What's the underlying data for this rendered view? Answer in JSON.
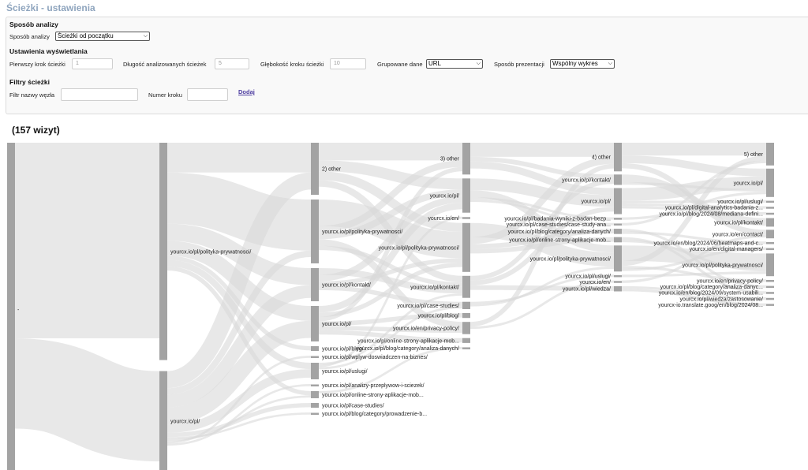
{
  "page_title": "Ścieżki - ustawienia",
  "analysis": {
    "section_title": "Sposób analizy",
    "method_label": "Sposób analizy",
    "method_value": "Ścieżki od początku"
  },
  "display": {
    "section_title": "Ustawienia wyświetlania",
    "first_step_label": "Pierwszy krok ścieżki",
    "first_step_value": "1",
    "length_label": "Długość analizowanych ścieżek",
    "length_value": "5",
    "depth_label": "Głębokość kroku ścieżki",
    "depth_value": "10",
    "grouped_label": "Grupowane dane",
    "grouped_value": "URL",
    "presentation_label": "Sposób prezentacji",
    "presentation_value": "Wspólny wykres"
  },
  "filters": {
    "section_title": "Filtry ścieżki",
    "node_name_label": "Filtr nazwy węzła",
    "step_number_label": "Numer kroku",
    "add_label": "Dodaj"
  },
  "visits_label": "(157 wizyt)",
  "colors": {
    "node": "#a3a3a3",
    "link": "#d8d8d8",
    "title": "#8fa5be",
    "link_text": "#4b3b9f"
  },
  "chart_data": {
    "type": "sankey",
    "total_visits": 157,
    "columns": [
      {
        "step": 0,
        "nodes": [
          {
            "id": "root",
            "label": "-",
            "value": 157
          }
        ]
      },
      {
        "step": 1,
        "nodes": [
          {
            "id": "s1-polityka",
            "label": "yourcx.io/pl/polityka-prywatnosci/",
            "value": 104
          },
          {
            "id": "s1-pl",
            "label": "yourcx.io/pl/",
            "value": 48
          }
        ]
      },
      {
        "step": 2,
        "nodes": [
          {
            "id": "s2-other",
            "label": "2) other",
            "value": 22
          },
          {
            "id": "s2-polityka",
            "label": "yourcx.io/pl/polityka-prywatnosci/",
            "value": 27
          },
          {
            "id": "s2-kontakt",
            "label": "yourcx.io/pl/kontakt/",
            "value": 14
          },
          {
            "id": "s2-pl",
            "label": "yourcx.io/pl/",
            "value": 15
          },
          {
            "id": "s2-blog",
            "label": "yourcx.io/pl/blog/",
            "value": 2
          },
          {
            "id": "s2-wplyw",
            "label": "yourcx.io/pl/wplyw-doswiadczen-na-biznes/",
            "value": 1
          },
          {
            "id": "s2-uslugi",
            "label": "yourcx.io/pl/uslugi/",
            "value": 7
          },
          {
            "id": "s2-analizy",
            "label": "yourcx.io/pl/analizy-przeplywow-i-sciezek/",
            "value": 1
          },
          {
            "id": "s2-online",
            "label": "yourcx.io/pl/online-strony-aplikacje-mob...",
            "value": 3
          },
          {
            "id": "s2-case",
            "label": "yourcx.io/pl/case-studies/",
            "value": 2
          },
          {
            "id": "s2-prowadzenie",
            "label": "yourcx.io/pl/blog/category/prowadzenie-b...",
            "value": 1
          }
        ]
      },
      {
        "step": 3,
        "nodes": [
          {
            "id": "s3-other",
            "label": "3) other",
            "value": 13
          },
          {
            "id": "s3-pl",
            "label": "yourcx.io/pl/",
            "value": 14
          },
          {
            "id": "s3-en",
            "label": "yourcx.io/en/",
            "value": 1
          },
          {
            "id": "s3-polityka",
            "label": "yourcx.io/pl/polityka-prywatnosci/",
            "value": 20
          },
          {
            "id": "s3-kontakt",
            "label": "yourcx.io/pl/kontakt/",
            "value": 9
          },
          {
            "id": "s3-case",
            "label": "yourcx.io/pl/case-studies/",
            "value": 3
          },
          {
            "id": "s3-blog",
            "label": "yourcx.io/pl/blog/",
            "value": 2
          },
          {
            "id": "s3-privacy",
            "label": "yourcx.io/en/privacy-policy/",
            "value": 5
          },
          {
            "id": "s3-online",
            "label": "yourcx.io/pl/online-strony-aplikacje-mob...",
            "value": 2
          },
          {
            "id": "s3-analiza",
            "label": "yourcx.io/pl/blog/category/analiza-danych/",
            "value": 1
          }
        ]
      },
      {
        "step": 4,
        "nodes": [
          {
            "id": "s4-other",
            "label": "4) other",
            "value": 11
          },
          {
            "id": "s4-kontakt",
            "label": "yourcx.io/pl/kontakt/",
            "value": 4
          },
          {
            "id": "s4-pl",
            "label": "yourcx.io/pl/",
            "value": 10
          },
          {
            "id": "s4-badania",
            "label": "yourcx.io/pl/badania-wyniki-z-badan-bezp...",
            "value": 1
          },
          {
            "id": "s4-case",
            "label": "yourcx.io/pl/case-studies/case-study-ana...",
            "value": 1
          },
          {
            "id": "s4-analiza",
            "label": "yourcx.io/pl/blog/category/analiza-danych/",
            "value": 2
          },
          {
            "id": "s4-online",
            "label": "yourcx.io/pl/online-strony-aplikacje-mob...",
            "value": 2
          },
          {
            "id": "s4-polityka",
            "label": "yourcx.io/pl/polityka-prywatnosci/",
            "value": 10
          },
          {
            "id": "s4-uslugi",
            "label": "yourcx.io/pl/uslugi/",
            "value": 1
          },
          {
            "id": "s4-en",
            "label": "yourcx.io/en/",
            "value": 1
          },
          {
            "id": "s4-wiedza",
            "label": "yourcx.io/pl/wiedza/",
            "value": 2
          }
        ]
      },
      {
        "step": 5,
        "nodes": [
          {
            "id": "s5-other",
            "label": "5) other",
            "value": 8
          },
          {
            "id": "s5-pl",
            "label": "yourcx.io/pl/",
            "value": 10
          },
          {
            "id": "s5-uslugi",
            "label": "yourcx.io/pl/uslugi/",
            "value": 1
          },
          {
            "id": "s5-digital",
            "label": "yourcx.io/pl/digital-analytics-badania-z...",
            "value": 1
          },
          {
            "id": "s5-mediana",
            "label": "yourcx.io/pl/blog/2024/08/mediana-defini...",
            "value": 1
          },
          {
            "id": "s5-kontakt",
            "label": "yourcx.io/pl/kontakt/",
            "value": 3
          },
          {
            "id": "s5-contact",
            "label": "yourcx.io/en/contact/",
            "value": 3
          },
          {
            "id": "s5-heatmaps",
            "label": "yourcx.io/en/blog/2024/06/heatmaps-and-c...",
            "value": 1
          },
          {
            "id": "s5-managers",
            "label": "yourcx.io/en/digital-managers/",
            "value": 1
          },
          {
            "id": "s5-polityka",
            "label": "yourcx.io/pl/polityka-prywatnosci/",
            "value": 8
          },
          {
            "id": "s5-privacy",
            "label": "yourcx.io/en/privacy-policy/",
            "value": 1
          },
          {
            "id": "s5-analiza",
            "label": "yourcx.io/pl/blog/category/analiza-danyc...",
            "value": 1
          },
          {
            "id": "s5-usabili",
            "label": "yourcx.io/en/blog/2024/09/system-usabili...",
            "value": 1
          },
          {
            "id": "s5-wiedza",
            "label": "yourcx.io/pl/wiedza/zastosowanie/",
            "value": 1
          },
          {
            "id": "s5-translate",
            "label": "yourcx-io.translate.goog/en/blog/2024/08...",
            "value": 1
          }
        ]
      }
    ],
    "links": [
      {
        "source": "root",
        "target": "s1-polityka",
        "value": 104
      },
      {
        "source": "root",
        "target": "s1-pl",
        "value": 48
      },
      {
        "source": "s1-polityka",
        "target": "s2-other",
        "value": 14
      },
      {
        "source": "s1-polityka",
        "target": "s2-polityka",
        "value": 24
      },
      {
        "source": "s1-polityka",
        "target": "s2-kontakt",
        "value": 8
      },
      {
        "source": "s1-polityka",
        "target": "s2-pl",
        "value": 7
      },
      {
        "source": "s1-polityka",
        "target": "s2-blog",
        "value": 2
      },
      {
        "source": "s1-polityka",
        "target": "s2-uslugi",
        "value": 3
      },
      {
        "source": "s1-polityka",
        "target": "s2-online",
        "value": 2
      },
      {
        "source": "s1-pl",
        "target": "s2-other",
        "value": 8
      },
      {
        "source": "s1-pl",
        "target": "s2-polityka",
        "value": 3
      },
      {
        "source": "s1-pl",
        "target": "s2-kontakt",
        "value": 6
      },
      {
        "source": "s1-pl",
        "target": "s2-pl",
        "value": 8
      },
      {
        "source": "s1-pl",
        "target": "s2-uslugi",
        "value": 4
      },
      {
        "source": "s1-pl",
        "target": "s2-case",
        "value": 2
      },
      {
        "source": "s1-pl",
        "target": "s2-prowadzenie",
        "value": 1
      },
      {
        "source": "s1-pl",
        "target": "s2-online",
        "value": 1
      },
      {
        "source": "s1-pl",
        "target": "s2-wplyw",
        "value": 1
      },
      {
        "source": "s1-pl",
        "target": "s2-analizy",
        "value": 1
      },
      {
        "source": "s2-other",
        "target": "s3-other",
        "value": 8
      },
      {
        "source": "s2-other",
        "target": "s3-pl",
        "value": 5
      },
      {
        "source": "s2-other",
        "target": "s3-polityka",
        "value": 4
      },
      {
        "source": "s2-other",
        "target": "s3-kontakt",
        "value": 3
      },
      {
        "source": "s2-polityka",
        "target": "s3-polityka",
        "value": 12
      },
      {
        "source": "s2-polityka",
        "target": "s3-other",
        "value": 3
      },
      {
        "source": "s2-polityka",
        "target": "s3-pl",
        "value": 3
      },
      {
        "source": "s2-polityka",
        "target": "s3-privacy",
        "value": 3
      },
      {
        "source": "s2-polityka",
        "target": "s3-kontakt",
        "value": 2
      },
      {
        "source": "s2-kontakt",
        "target": "s3-kontakt",
        "value": 3
      },
      {
        "source": "s2-kontakt",
        "target": "s3-pl",
        "value": 3
      },
      {
        "source": "s2-kontakt",
        "target": "s3-polityka",
        "value": 2
      },
      {
        "source": "s2-kontakt",
        "target": "s3-case",
        "value": 2
      },
      {
        "source": "s2-pl",
        "target": "s3-pl",
        "value": 3
      },
      {
        "source": "s2-pl",
        "target": "s3-polityka",
        "value": 2
      },
      {
        "source": "s2-pl",
        "target": "s3-other",
        "value": 2
      },
      {
        "source": "s2-pl",
        "target": "s3-blog",
        "value": 2
      },
      {
        "source": "s2-pl",
        "target": "s3-privacy",
        "value": 2
      },
      {
        "source": "s2-pl",
        "target": "s3-online",
        "value": 2
      },
      {
        "source": "s2-uslugi",
        "target": "s3-kontakt",
        "value": 1
      },
      {
        "source": "s2-uslugi",
        "target": "s3-en",
        "value": 1
      },
      {
        "source": "s2-uslugi",
        "target": "s3-case",
        "value": 1
      },
      {
        "source": "s2-online",
        "target": "s3-analiza",
        "value": 1
      },
      {
        "source": "s3-other",
        "target": "s4-other",
        "value": 6
      },
      {
        "source": "s3-other",
        "target": "s4-kontakt",
        "value": 2
      },
      {
        "source": "s3-other",
        "target": "s4-pl",
        "value": 3
      },
      {
        "source": "s3-pl",
        "target": "s4-pl",
        "value": 5
      },
      {
        "source": "s3-pl",
        "target": "s4-polityka",
        "value": 3
      },
      {
        "source": "s3-pl",
        "target": "s4-badania",
        "value": 1
      },
      {
        "source": "s3-pl",
        "target": "s4-case",
        "value": 1
      },
      {
        "source": "s3-polityka",
        "target": "s4-polityka",
        "value": 6
      },
      {
        "source": "s3-polityka",
        "target": "s4-other",
        "value": 3
      },
      {
        "source": "s3-polityka",
        "target": "s4-analiza",
        "value": 2
      },
      {
        "source": "s3-polityka",
        "target": "s4-online",
        "value": 2
      },
      {
        "source": "s3-kontakt",
        "target": "s4-kontakt",
        "value": 2
      },
      {
        "source": "s3-kontakt",
        "target": "s4-pl",
        "value": 2
      },
      {
        "source": "s3-kontakt",
        "target": "s4-wiedza",
        "value": 2
      },
      {
        "source": "s3-privacy",
        "target": "s4-other",
        "value": 2
      },
      {
        "source": "s3-privacy",
        "target": "s4-en",
        "value": 1
      },
      {
        "source": "s3-case",
        "target": "s4-uslugi",
        "value": 1
      },
      {
        "source": "s3-case",
        "target": "s4-polityka",
        "value": 1
      },
      {
        "source": "s4-other",
        "target": "s5-other",
        "value": 5
      },
      {
        "source": "s4-other",
        "target": "s5-pl",
        "value": 3
      },
      {
        "source": "s4-other",
        "target": "s5-contact",
        "value": 2
      },
      {
        "source": "s4-pl",
        "target": "s5-pl",
        "value": 5
      },
      {
        "source": "s4-pl",
        "target": "s5-uslugi",
        "value": 1
      },
      {
        "source": "s4-pl",
        "target": "s5-digital",
        "value": 1
      },
      {
        "source": "s4-pl",
        "target": "s5-mediana",
        "value": 1
      },
      {
        "source": "s4-kontakt",
        "target": "s5-kontakt",
        "value": 3
      },
      {
        "source": "s4-kontakt",
        "target": "s5-pl",
        "value": 1
      },
      {
        "source": "s4-polityka",
        "target": "s5-polityka",
        "value": 6
      },
      {
        "source": "s4-polityka",
        "target": "s5-other",
        "value": 2
      },
      {
        "source": "s4-polityka",
        "target": "s5-privacy",
        "value": 1
      },
      {
        "source": "s4-polityka",
        "target": "s5-managers",
        "value": 1
      },
      {
        "source": "s4-analiza",
        "target": "s5-analiza",
        "value": 1
      },
      {
        "source": "s4-analiza",
        "target": "s5-heatmaps",
        "value": 1
      },
      {
        "source": "s4-online",
        "target": "s5-usabili",
        "value": 1
      },
      {
        "source": "s4-online",
        "target": "s5-polityka",
        "value": 1
      },
      {
        "source": "s4-wiedza",
        "target": "s5-wiedza",
        "value": 1
      },
      {
        "source": "s4-wiedza",
        "target": "s5-translate",
        "value": 1
      },
      {
        "source": "s4-en",
        "target": "s5-contact",
        "value": 1
      },
      {
        "source": "s4-uslugi",
        "target": "s5-polityka",
        "value": 1
      },
      {
        "source": "s4-badania",
        "target": "s5-pl",
        "value": 1
      },
      {
        "source": "s4-case",
        "target": "s5-other",
        "value": 1
      }
    ]
  }
}
